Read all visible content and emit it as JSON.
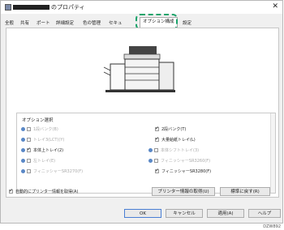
{
  "window": {
    "title": "のプロパティ"
  },
  "tabs": [
    {
      "label": "全般"
    },
    {
      "label": "共有"
    },
    {
      "label": "ポート"
    },
    {
      "label": "詳細設定"
    },
    {
      "label": "色の管理"
    },
    {
      "label": "セキュ"
    },
    {
      "label": "オプション構成"
    },
    {
      "label": "設定"
    }
  ],
  "options_group": {
    "title": "オプション選択",
    "items": [
      {
        "label": "1段バンク(B)",
        "checked": false,
        "enabled": false
      },
      {
        "label": "2段バンク(T)",
        "checked": true,
        "enabled": true
      },
      {
        "label": "トレイ3(LCT)(Y)",
        "checked": false,
        "enabled": false
      },
      {
        "label": "大量給紙トレイ(L)",
        "checked": true,
        "enabled": true
      },
      {
        "label": "本体上トレイ(2)",
        "checked": true,
        "enabled": true
      },
      {
        "label": "本体シフトトレイ(3)",
        "checked": false,
        "enabled": false
      },
      {
        "label": "左トレイ(E)",
        "checked": false,
        "enabled": false
      },
      {
        "label": "フィニッシャーSR3260(F)",
        "checked": false,
        "enabled": false
      },
      {
        "label": "フィニッシャーSR3270(F)",
        "checked": false,
        "enabled": false
      },
      {
        "label": "フィニッシャーSR3280(F)",
        "checked": true,
        "enabled": true
      }
    ]
  },
  "auto_fetch": {
    "label": "自動的にプリンター情報を取得(A)",
    "checked": true
  },
  "buttons": {
    "fetch": "プリンター情報の取得(U)",
    "reset": "標準に戻す(R)",
    "ok": "OK",
    "cancel": "キャンセル",
    "apply": "適用(A)",
    "help": "ヘルプ"
  },
  "figure_code": "DZW892"
}
